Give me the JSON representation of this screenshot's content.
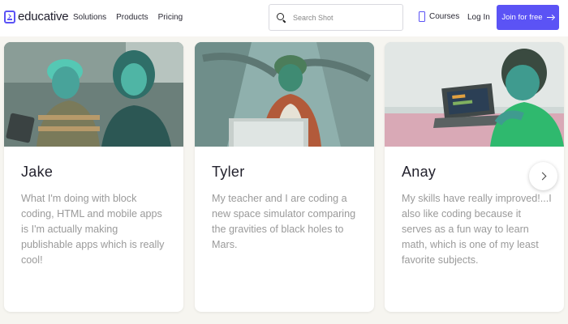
{
  "brand": {
    "name": "educative"
  },
  "nav": {
    "solutions": "Solutions",
    "products": "Products",
    "pricing": "Pricing"
  },
  "search": {
    "placeholder": "Search Shot"
  },
  "courses": {
    "label": "Courses"
  },
  "login": {
    "label": "Log In"
  },
  "join": {
    "label": "Join for free"
  },
  "cards": [
    {
      "name": "Jake",
      "quote": "What I'm doing with block coding, HTML and mobile apps is I'm actually making publishable apps which is really cool!"
    },
    {
      "name": "Tyler",
      "quote": "My teacher and I are coding a new space simulator comparing the gravities of black holes to Mars."
    },
    {
      "name": "Anay",
      "quote": "My skills have really improved!...I also like coding because it serves as a fun way to learn math, which is one of my least favorite subjects."
    }
  ],
  "colors": {
    "accent": "#5b53f5",
    "background": "#f6f5f0",
    "card": "#ffffff",
    "quote_text": "#9a9a9a"
  },
  "icons": {
    "logo": "code-terminal-icon",
    "search": "search-icon",
    "courses": "phone-icon",
    "join": "arrow-right-icon",
    "next": "chevron-right-icon"
  }
}
